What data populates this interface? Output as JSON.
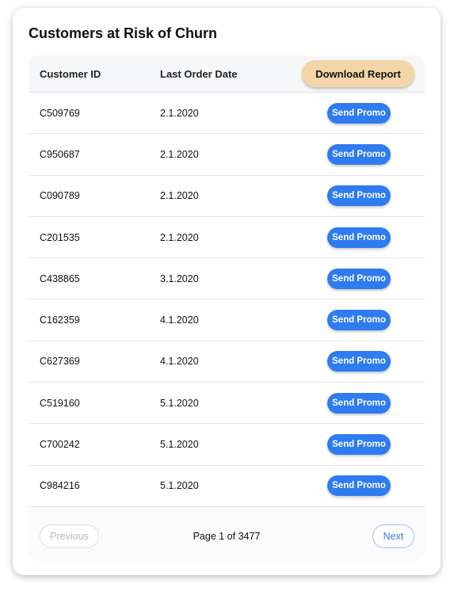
{
  "card": {
    "title": "Customers at Risk of Churn"
  },
  "table": {
    "columns": {
      "customer_id": "Customer ID",
      "last_order_date": "Last Order Date"
    },
    "download_label": "Download Report",
    "promo_label": "Send Promo",
    "rows": [
      {
        "id": "C509769",
        "date": "2.1.2020"
      },
      {
        "id": "C950687",
        "date": "2.1.2020"
      },
      {
        "id": "C090789",
        "date": "2.1.2020"
      },
      {
        "id": "C201535",
        "date": "2.1.2020"
      },
      {
        "id": "C438865",
        "date": "3.1.2020"
      },
      {
        "id": "C162359",
        "date": "4.1.2020"
      },
      {
        "id": "C627369",
        "date": "4.1.2020"
      },
      {
        "id": "C519160",
        "date": "5.1.2020"
      },
      {
        "id": "C700242",
        "date": "5.1.2020"
      },
      {
        "id": "C984216",
        "date": "5.1.2020"
      }
    ]
  },
  "pagination": {
    "previous_label": "Previous",
    "next_label": "Next",
    "page_info": "Page 1 of 3477",
    "previous_disabled": true
  },
  "colors": {
    "download_button": "#f2d6a8",
    "promo_button": "#2f7bf0",
    "next_button_text": "#2f7bf0"
  }
}
